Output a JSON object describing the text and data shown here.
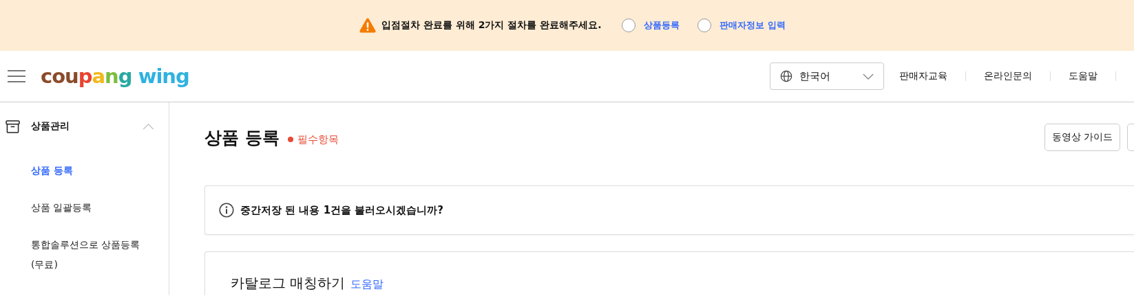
{
  "notice": {
    "message": "입점절차 완료를 위해 2가지 절차를 완료해주세요.",
    "steps": [
      {
        "label": "상품등록",
        "checked": false
      },
      {
        "label": "판매자정보 입력",
        "checked": false
      }
    ]
  },
  "header": {
    "logo": [
      {
        "text": "cou",
        "color": "#8a4b2a"
      },
      {
        "text": "p",
        "color": "#e8432f"
      },
      {
        "text": "a",
        "color": "#f2b91c"
      },
      {
        "text": "n",
        "color": "#7cbd3c"
      },
      {
        "text": "g",
        "color": "#28a9a0"
      },
      {
        "text": " wing",
        "color": "#2fb2e0"
      }
    ],
    "language": "한국어",
    "links": [
      "판매자교육",
      "온라인문의",
      "도움말"
    ]
  },
  "sidebar": {
    "category": {
      "label": "상품관리",
      "expanded": true
    },
    "items": [
      {
        "label": "상품 등록",
        "selected": true
      },
      {
        "label": "상품 일괄등록",
        "selected": false
      },
      {
        "label": "통합솔루션으로 상품등록 (무료)",
        "selected": false
      }
    ]
  },
  "main": {
    "title": "상품 등록",
    "required_note": "필수항목",
    "buttons": [
      "동영상 가이드"
    ],
    "draft_notice": "중간저장 된 내용 1건을 불러오시겠습니까?",
    "section": {
      "title": "카탈로그 매칭하기",
      "help_link": "도움말"
    }
  }
}
